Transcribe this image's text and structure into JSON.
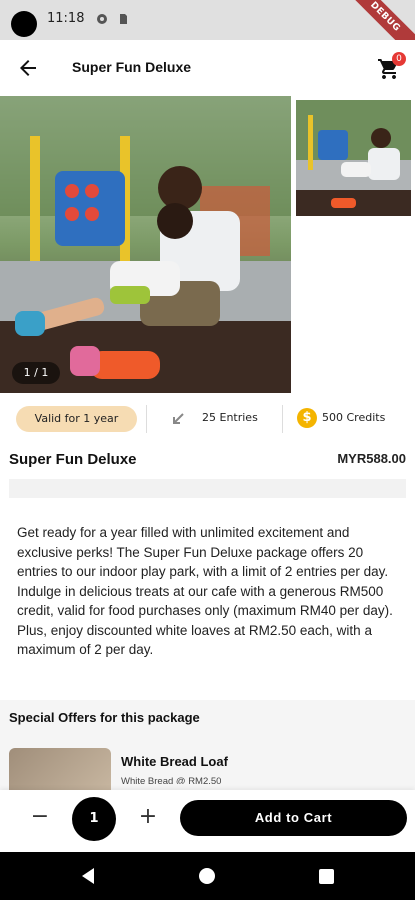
{
  "status_bar": {
    "time": "11:18",
    "debug_label": "DEBUG"
  },
  "app_bar": {
    "title": "Super Fun Deluxe",
    "cart_count": "0"
  },
  "gallery": {
    "counter": "1 / 1"
  },
  "info": {
    "validity": "Valid for 1 year",
    "entries": "25 Entries",
    "credits": "500 Credits",
    "credit_symbol": "$"
  },
  "product": {
    "title": "Super Fun Deluxe",
    "price": "MYR588.00",
    "description": "Get ready for a year filled with unlimited excitement and exclusive perks! The Super Fun Deluxe package offers 20 entries to our indoor play park, with a limit of 2 entries per day. Indulge in delicious treats at our cafe with a generous RM500 credit, valid for food purchases only (maximum RM40 per day). Plus, enjoy discounted white loaves at RM2.50 each, with a maximum of 2 per day."
  },
  "offers": {
    "section_title": "Special Offers for this package",
    "items": [
      {
        "name": "White Bread Loaf",
        "subtitle": "White Bread @ RM2.50"
      }
    ]
  },
  "purchase": {
    "minus": "−",
    "quantity": "1",
    "plus": "+",
    "add_to_cart": "Add to Cart"
  },
  "colors": {
    "badge_bg": "#f6dcb3",
    "coin": "#f4b400",
    "cart_badge": "#e53935",
    "primary": "#000000"
  }
}
